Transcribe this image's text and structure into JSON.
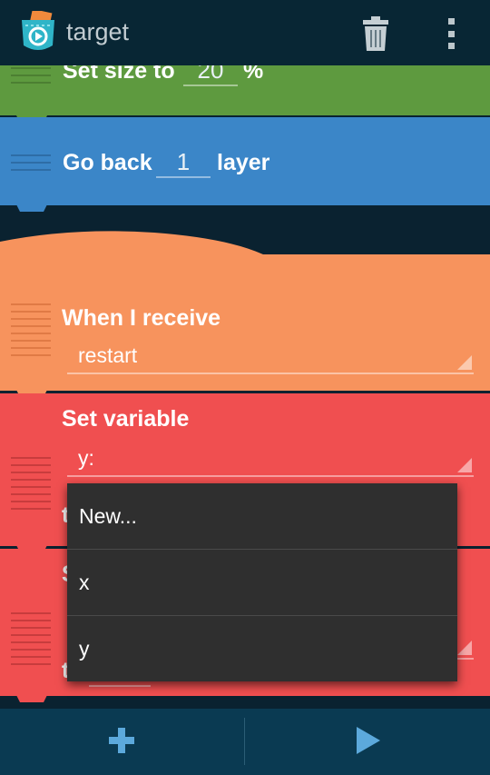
{
  "actionbar": {
    "title": "target",
    "app_icon": "pocket-code-icon",
    "trash_icon": "trash-icon",
    "overflow_icon": "overflow-menu-icon"
  },
  "bricks": {
    "set_size": {
      "label": "Set size to",
      "value": "20",
      "unit": "%"
    },
    "go_back": {
      "label": "Go back",
      "value": "1",
      "unit": "layer"
    },
    "when_receive": {
      "label": "When I receive",
      "message": "restart"
    },
    "set_variable": {
      "label": "Set variable",
      "variable": "y:",
      "partial_label": "t"
    },
    "second_red": {
      "partial_label_top": "S",
      "partial_label_bottom": "t"
    }
  },
  "dropdown": {
    "items": [
      "New...",
      "x",
      "y"
    ]
  },
  "bottombar": {
    "add_icon": "plus-icon",
    "play_icon": "play-icon"
  },
  "colors": {
    "actionbar": "#082634",
    "green_brick": "#5e9a3f",
    "blue_brick": "#3b86c8",
    "orange_brick": "#f7935d",
    "red_brick": "#f04f50",
    "dropdown_bg": "#2f2f2f",
    "bottombar": "#0a3a52",
    "accent": "#5ca9dc"
  }
}
